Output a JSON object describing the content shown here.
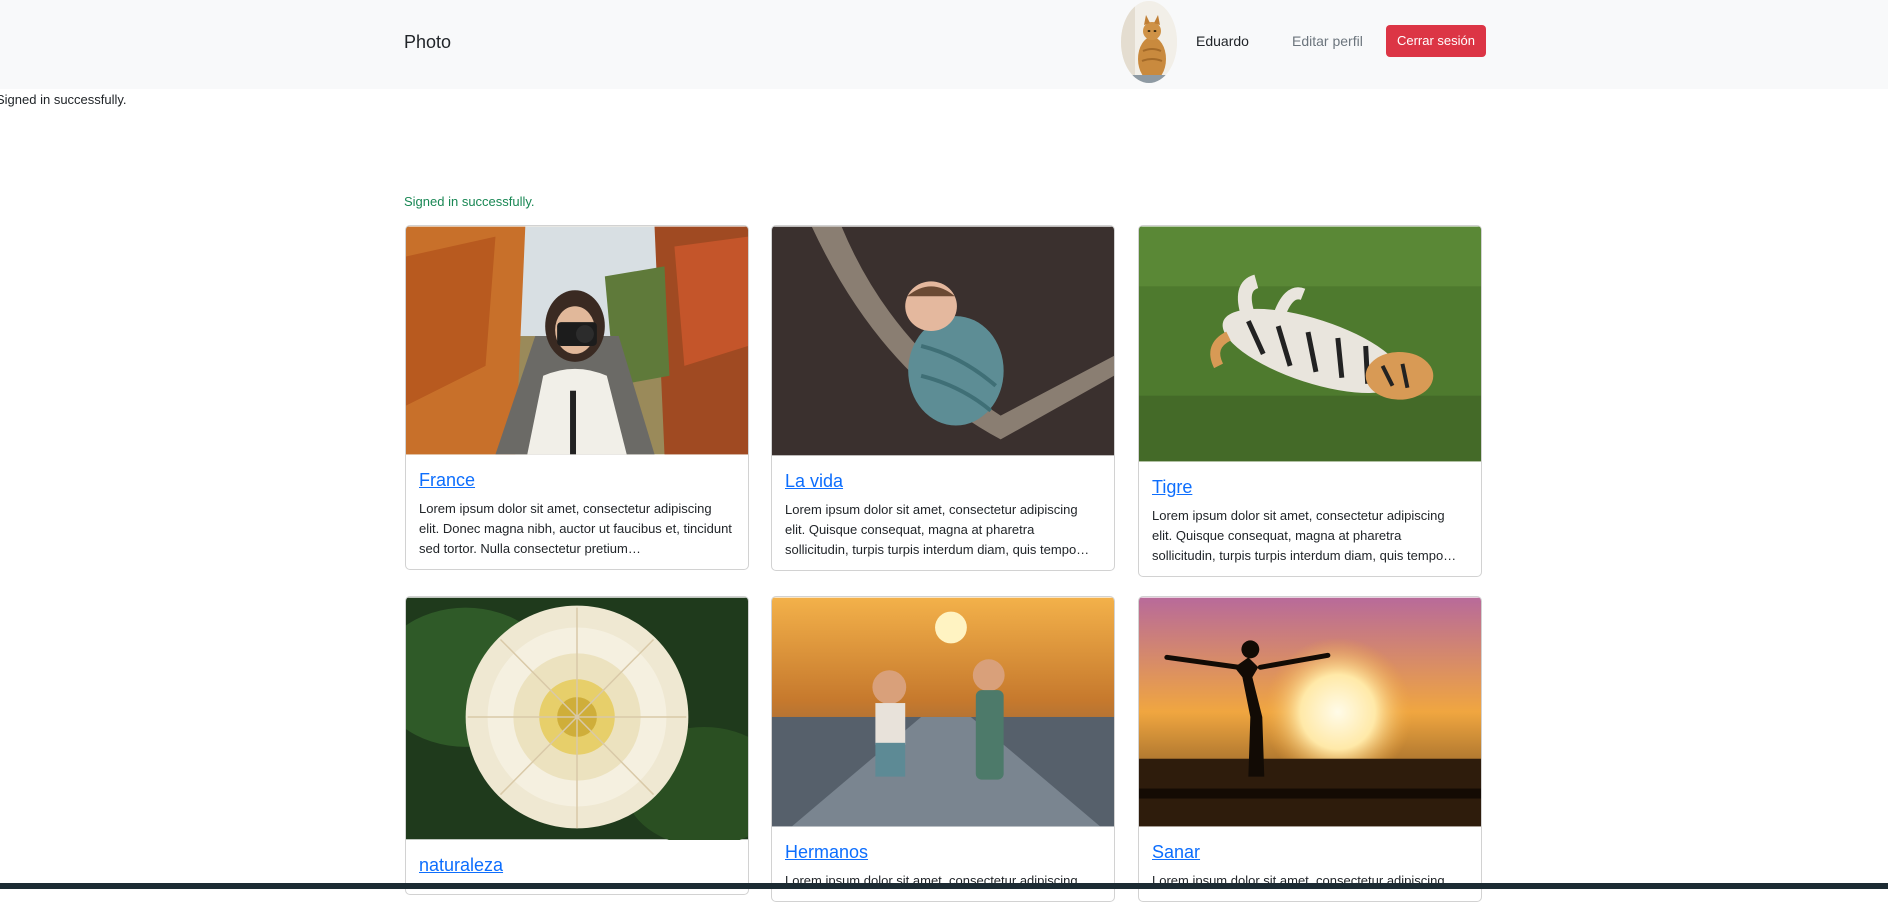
{
  "navbar": {
    "brand": "Photo",
    "user_name": "Eduardo",
    "edit_profile": "Editar perfil",
    "logout": "Cerrar sesión"
  },
  "flash": {
    "top": "Signed in successfully.",
    "notice": "Signed in successfully.",
    "notice_color": "#198754"
  },
  "colors": {
    "logout_button": "#dc3545",
    "link": "#0d6efd"
  },
  "posts": [
    {
      "title": "France",
      "excerpt": "Lorem ipsum dolor sit amet, consectetur adipiscing elit. Donec magna nibh, auctor ut faucibus et, tincidunt sed tortor. Nulla consectetur pretium…"
    },
    {
      "title": "La vida",
      "excerpt": "Lorem ipsum dolor sit amet, consectetur adipiscing elit. Quisque consequat, magna at pharetra sollicitudin, turpis turpis interdum diam, quis tempo…"
    },
    {
      "title": "Tigre",
      "excerpt": "Lorem ipsum dolor sit amet, consectetur adipiscing elit. Quisque consequat, magna at pharetra sollicitudin, turpis turpis interdum diam, quis tempo…"
    },
    {
      "title": "naturaleza",
      "excerpt": ""
    },
    {
      "title": "Hermanos",
      "excerpt": "Lorem ipsum dolor sit amet, consectetur adipiscing"
    },
    {
      "title": "Sanar",
      "excerpt": "Lorem ipsum dolor sit amet, consectetur adipiscing"
    }
  ]
}
